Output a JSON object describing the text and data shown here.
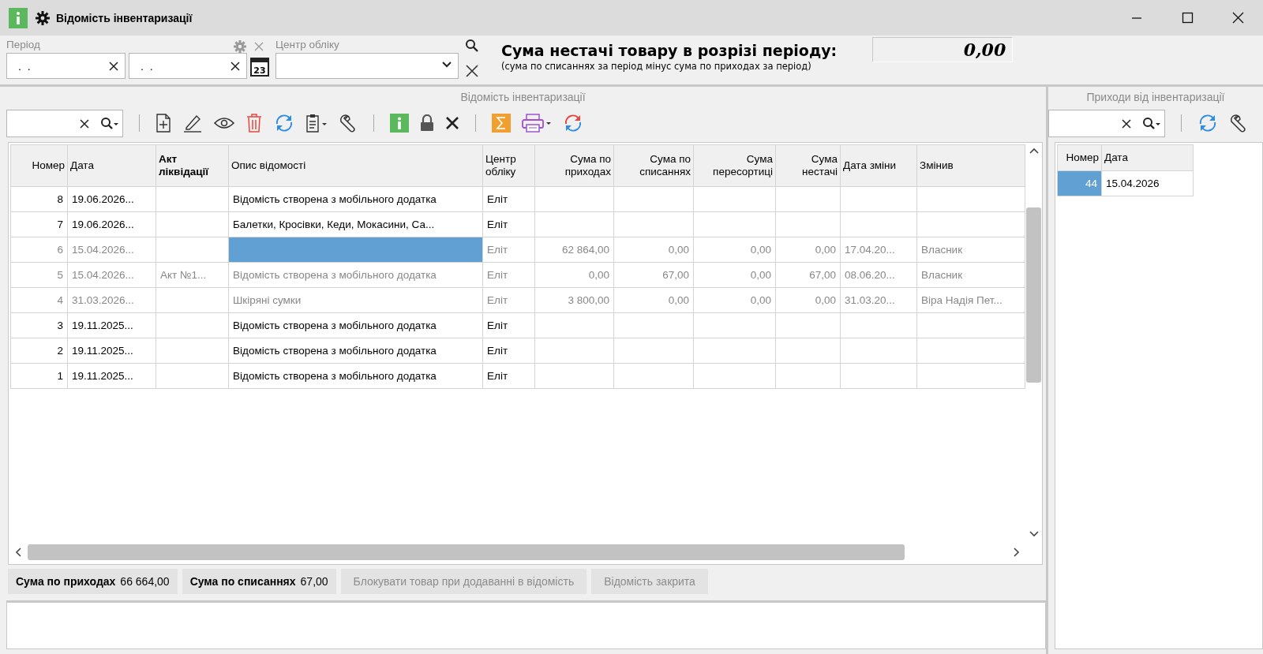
{
  "window": {
    "title": "Відомість інвентаризації"
  },
  "filters": {
    "period_label": "Період",
    "date_from": ". .",
    "date_to": ". .",
    "calendar_day": "23",
    "center_label": "Центр обліку"
  },
  "shortage": {
    "title": "Сума нестачі товару в розрізі періоду:",
    "note": "(сума по списаннях за період мінус сума по приходах за період)",
    "value": "0,00"
  },
  "main": {
    "title": "Відомість інвентаризації",
    "toolbar": [
      {
        "kind": "search"
      },
      {
        "kind": "separator"
      },
      {
        "kind": "add"
      },
      {
        "kind": "edit"
      },
      {
        "kind": "view"
      },
      {
        "kind": "delete"
      },
      {
        "kind": "refresh"
      },
      {
        "kind": "clipboard"
      },
      {
        "kind": "wrench"
      },
      {
        "kind": "separator"
      },
      {
        "kind": "info"
      },
      {
        "kind": "lock"
      },
      {
        "kind": "cancel"
      },
      {
        "kind": "separator"
      },
      {
        "kind": "sum"
      },
      {
        "kind": "print"
      },
      {
        "kind": "reload"
      }
    ],
    "table": {
      "columns": [
        {
          "label": "Номер",
          "highlighted": false
        },
        {
          "label": "Дата",
          "highlighted": false
        },
        {
          "label": "Акт ліквідації",
          "highlighted": true
        },
        {
          "label": "Опис відомості",
          "highlighted": false
        },
        {
          "label": "Центр обліку",
          "highlighted": false
        },
        {
          "label": "Сума по приходах",
          "highlighted": false
        },
        {
          "label": "Сума по списаннях",
          "highlighted": false
        },
        {
          "label": "Сума пересортиці",
          "highlighted": false
        },
        {
          "label": "Сума нестачі",
          "highlighted": false
        },
        {
          "label": "Дата зміни",
          "highlighted": false
        },
        {
          "label": "Змінив",
          "highlighted": false
        }
      ],
      "rows": [
        {
          "cells": [
            "8",
            "19.06.2026...",
            null,
            "Відомість створена з мобільного додатка",
            "Еліт",
            null,
            null,
            null,
            null,
            null,
            null
          ],
          "dimmed": false,
          "selected": false
        },
        {
          "cells": [
            "7",
            "19.06.2026...",
            null,
            "Балетки, Кросівки, Кеди, Мокасини, Са...",
            "Еліт",
            null,
            null,
            null,
            null,
            null,
            null
          ],
          "dimmed": false,
          "selected": false
        },
        {
          "cells": [
            "6",
            "15.04.2026...",
            null,
            null,
            "Еліт",
            "62 864,00",
            "0,00",
            "0,00",
            "0,00",
            "17.04.20...",
            "Власник"
          ],
          "dimmed": true,
          "selected": true
        },
        {
          "cells": [
            "5",
            "15.04.2026...",
            "Акт №1...",
            "Відомість створена з мобільного додатка",
            "Еліт",
            "0,00",
            "67,00",
            "0,00",
            "67,00",
            "08.06.20...",
            "Власник"
          ],
          "dimmed": true,
          "selected": false
        },
        {
          "cells": [
            "4",
            "31.03.2026...",
            null,
            "Шкіряні сумки",
            "Еліт",
            "3 800,00",
            "0,00",
            "0,00",
            "0,00",
            "31.03.20...",
            "Віра Надія Пет..."
          ],
          "dimmed": true,
          "selected": false
        },
        {
          "cells": [
            "3",
            "19.11.2025...",
            null,
            "Відомість створена з мобільного додатка",
            "Еліт",
            null,
            null,
            null,
            null,
            null,
            null
          ],
          "dimmed": false,
          "selected": false
        },
        {
          "cells": [
            "2",
            "19.11.2025...",
            null,
            "Відомість створена з мобільного додатка",
            "Еліт",
            null,
            null,
            null,
            null,
            null,
            null
          ],
          "dimmed": false,
          "selected": false
        },
        {
          "cells": [
            "1",
            "19.11.2025...",
            null,
            "Відомість створена з мобільного додатка",
            "Еліт",
            null,
            null,
            null,
            null,
            null,
            null
          ],
          "dimmed": false,
          "selected": false
        }
      ]
    },
    "totals": [
      {
        "label": "Сума по приходах",
        "value": "66 664,00"
      },
      {
        "label": "Сума по списаннях",
        "value": "67,00"
      }
    ],
    "options": [
      {
        "label": "Блокувати товар при додаванні в відомість",
        "disabled": true
      },
      {
        "label": "Відомість закрита",
        "disabled": true
      }
    ]
  },
  "receipts": {
    "title": "Приходи від інвентаризації",
    "toolbar": [
      {
        "kind": "search"
      },
      {
        "kind": "separator"
      },
      {
        "kind": "refresh"
      },
      {
        "kind": "wrench"
      }
    ],
    "table": {
      "columns": [
        {
          "label": "Номер",
          "highlighted": false
        },
        {
          "label": "Дата",
          "highlighted": false
        }
      ],
      "rows": [
        {
          "cells": [
            "44",
            "15.04.2026"
          ],
          "selected": true
        }
      ]
    }
  }
}
